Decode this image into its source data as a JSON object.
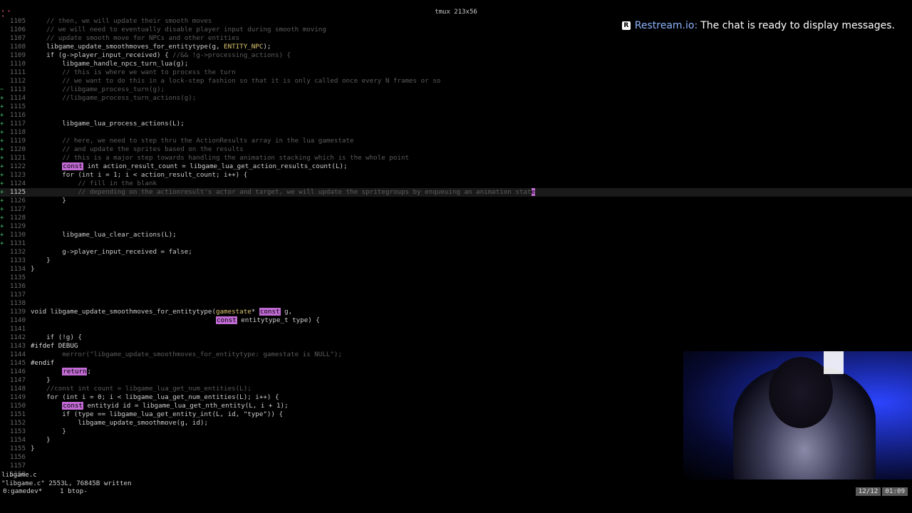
{
  "window": {
    "title": "tmux 213x56"
  },
  "overlay": {
    "brand": "Restream.io:",
    "message": "The chat is ready to display messages."
  },
  "editor": {
    "lines": [
      {
        "n": "1105",
        "s": "",
        "c": [
          {
            "t": "    "
          },
          {
            "t": "// then, we will update their smooth moves",
            "k": "cm"
          }
        ]
      },
      {
        "n": "1106",
        "s": "",
        "c": [
          {
            "t": "    "
          },
          {
            "t": "// we will need to eventually disable player input during smooth moving",
            "k": "cm"
          }
        ]
      },
      {
        "n": "1107",
        "s": "",
        "c": [
          {
            "t": "    "
          },
          {
            "t": "// update smooth move for NPCs and other entities",
            "k": "cm"
          }
        ]
      },
      {
        "n": "1108",
        "s": "",
        "c": [
          {
            "t": "    libgame_update_smoothmoves_for_entitytype(g, "
          },
          {
            "t": "ENTITY_NPC",
            "k": "ty"
          },
          {
            "t": ");"
          }
        ]
      },
      {
        "n": "1109",
        "s": "",
        "c": [
          {
            "t": "    if (g->player_input_received) { "
          },
          {
            "t": "//&& !g->processing_actions) {",
            "k": "cm"
          }
        ]
      },
      {
        "n": "1110",
        "s": "",
        "c": [
          {
            "t": "        libgame_handle_npcs_turn_lua(g);"
          }
        ]
      },
      {
        "n": "1111",
        "s": "",
        "c": [
          {
            "t": "        "
          },
          {
            "t": "// this is where we want to process the turn",
            "k": "cm"
          }
        ]
      },
      {
        "n": "1112",
        "s": "",
        "c": [
          {
            "t": "        "
          },
          {
            "t": "// we want to do this in a lock-step fashion so that it is only called once every N frames or so",
            "k": "cm"
          }
        ]
      },
      {
        "n": "1113",
        "s": "~",
        "c": [
          {
            "t": "        "
          },
          {
            "t": "//libgame_process_turn(g);",
            "k": "cm"
          }
        ]
      },
      {
        "n": "1114",
        "s": "+",
        "c": [
          {
            "t": "        "
          },
          {
            "t": "//libgame_process_turn_actions(g);",
            "k": "cm"
          }
        ]
      },
      {
        "n": "1115",
        "s": "+",
        "c": []
      },
      {
        "n": "1116",
        "s": "+",
        "c": []
      },
      {
        "n": "1117",
        "s": "+",
        "c": [
          {
            "t": "        libgame_lua_process_actions(L);"
          }
        ]
      },
      {
        "n": "1118",
        "s": "+",
        "c": []
      },
      {
        "n": "1119",
        "s": "+",
        "c": [
          {
            "t": "        "
          },
          {
            "t": "// here, we need to step thru the ActionResults array in the lua gamestate",
            "k": "cm"
          }
        ]
      },
      {
        "n": "1120",
        "s": "+",
        "c": [
          {
            "t": "        "
          },
          {
            "t": "// and update the sprites based on the results",
            "k": "cm"
          }
        ]
      },
      {
        "n": "1121",
        "s": "+",
        "c": [
          {
            "t": "        "
          },
          {
            "t": "// this is a major step towards handling the animation stacking which is the whole point",
            "k": "cm"
          }
        ]
      },
      {
        "n": "1122",
        "s": "+",
        "c": [
          {
            "t": "        "
          },
          {
            "t": "const",
            "k": "hl"
          },
          {
            "t": " int action_result_count = libgame_lua_get_action_results_count(L);"
          }
        ]
      },
      {
        "n": "1123",
        "s": "+",
        "c": [
          {
            "t": "        for (int i = 1; i < action_result_count; i++) {"
          }
        ]
      },
      {
        "n": "1124",
        "s": "+",
        "c": [
          {
            "t": "            "
          },
          {
            "t": "// fill in the blank",
            "k": "cm"
          }
        ]
      },
      {
        "n": "1125",
        "s": "+",
        "cur": true,
        "c": [
          {
            "t": "            "
          },
          {
            "t": "// depending on the actionresult's actor and target, we will update the spritegroups by enqueuing an animation stat",
            "k": "cm"
          },
          {
            "t": "e",
            "k": "cursor"
          }
        ]
      },
      {
        "n": "1126",
        "s": "+",
        "c": [
          {
            "t": "        }"
          }
        ]
      },
      {
        "n": "1127",
        "s": "+",
        "c": []
      },
      {
        "n": "1128",
        "s": "+",
        "c": []
      },
      {
        "n": "1129",
        "s": "+",
        "c": []
      },
      {
        "n": "1130",
        "s": "+",
        "c": [
          {
            "t": "        libgame_lua_clear_actions(L);"
          }
        ]
      },
      {
        "n": "1131",
        "s": "+",
        "c": []
      },
      {
        "n": "1132",
        "s": "",
        "c": [
          {
            "t": "        g->player_input_received = false;"
          }
        ]
      },
      {
        "n": "1133",
        "s": "",
        "c": [
          {
            "t": "    }"
          }
        ]
      },
      {
        "n": "1134",
        "s": "",
        "c": [
          {
            "t": "}"
          }
        ]
      },
      {
        "n": "1135",
        "s": "",
        "c": []
      },
      {
        "n": "1136",
        "s": "",
        "c": []
      },
      {
        "n": "1137",
        "s": "",
        "c": []
      },
      {
        "n": "1138",
        "s": "",
        "c": []
      },
      {
        "n": "1139",
        "s": "",
        "c": [
          {
            "t": "void libgame_update_smoothmoves_for_entitytype("
          },
          {
            "t": "gamestate",
            "k": "ty"
          },
          {
            "t": "* "
          },
          {
            "t": "const",
            "k": "hl"
          },
          {
            "t": " g,"
          }
        ]
      },
      {
        "n": "1140",
        "s": "",
        "c": [
          {
            "t": "                                               "
          },
          {
            "t": "const",
            "k": "hl"
          },
          {
            "t": " entitytype_t type) {"
          }
        ]
      },
      {
        "n": "1141",
        "s": "",
        "c": []
      },
      {
        "n": "1142",
        "s": "",
        "c": [
          {
            "t": "    if (!g) {"
          }
        ]
      },
      {
        "n": "1143",
        "s": "",
        "c": [
          {
            "t": "#ifdef DEBUG",
            "k": "pp"
          }
        ]
      },
      {
        "n": "1144",
        "s": "",
        "c": [
          {
            "t": "        "
          },
          {
            "t": "merror(\"libgame_update_smoothmoves_for_entitytype: gamestate is NULL\");",
            "k": "cm"
          }
        ]
      },
      {
        "n": "1145",
        "s": "",
        "c": [
          {
            "t": "#endif",
            "k": "pp"
          }
        ]
      },
      {
        "n": "1146",
        "s": "",
        "c": [
          {
            "t": "        "
          },
          {
            "t": "return",
            "k": "hl"
          },
          {
            "t": ";"
          }
        ]
      },
      {
        "n": "1147",
        "s": "",
        "c": [
          {
            "t": "    }"
          }
        ]
      },
      {
        "n": "1148",
        "s": "",
        "c": [
          {
            "t": "    "
          },
          {
            "t": "//const int count = libgame_lua_get_num_entities(L);",
            "k": "cm"
          }
        ]
      },
      {
        "n": "1149",
        "s": "",
        "c": [
          {
            "t": "    for (int i = 0; i < libgame_lua_get_num_entities(L); i++) {"
          }
        ]
      },
      {
        "n": "1150",
        "s": "",
        "c": [
          {
            "t": "        "
          },
          {
            "t": "const",
            "k": "hl"
          },
          {
            "t": " entityid id = libgame_lua_get_nth_entity(L, i + 1);"
          }
        ]
      },
      {
        "n": "1151",
        "s": "",
        "c": [
          {
            "t": "        if (type == libgame_lua_get_entity_int(L, id, \"type\")) {"
          }
        ]
      },
      {
        "n": "1152",
        "s": "",
        "c": [
          {
            "t": "            libgame_update_smoothmove(g, id);"
          }
        ]
      },
      {
        "n": "1153",
        "s": "",
        "c": [
          {
            "t": "        }"
          }
        ]
      },
      {
        "n": "1154",
        "s": "",
        "c": [
          {
            "t": "    }"
          }
        ]
      },
      {
        "n": "1155",
        "s": "",
        "c": [
          {
            "t": "}"
          }
        ]
      },
      {
        "n": "1156",
        "s": "",
        "c": []
      },
      {
        "n": "1157",
        "s": "",
        "c": []
      },
      {
        "n": "1158",
        "s": "",
        "c": []
      }
    ]
  },
  "statusline": {
    "filename": "libgame.c"
  },
  "message": {
    "text": "\"libgame.c\" 2553L, 76845B written"
  },
  "tmux": {
    "window1": "0:gamedev*",
    "window2": "1 btop-",
    "date": "12/12",
    "time": "01:09"
  }
}
